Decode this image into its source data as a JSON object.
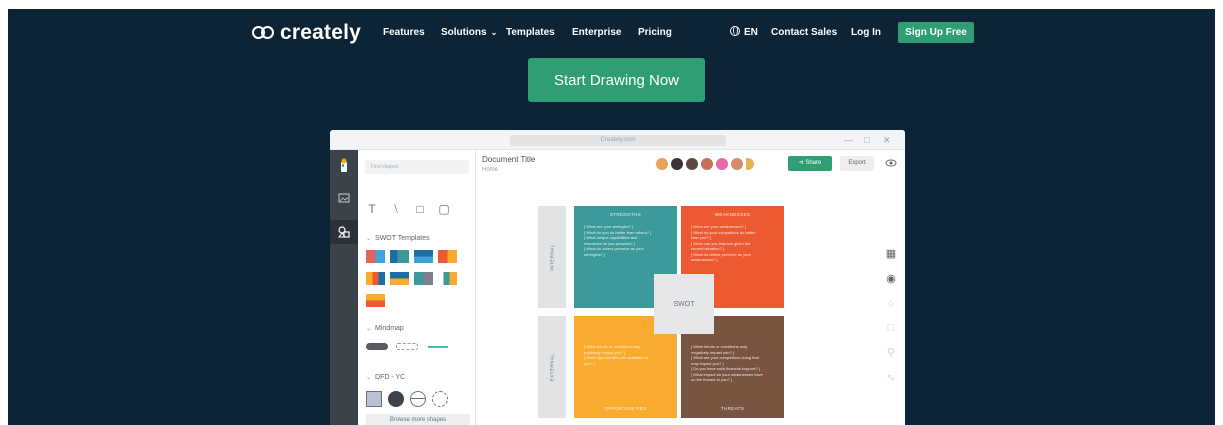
{
  "nav": {
    "logo_text": "creately",
    "features": "Features",
    "solutions": "Solutions",
    "templates": "Templates",
    "enterprise": "Enterprise",
    "pricing": "Pricing",
    "language": "EN",
    "contact_sales": "Contact Sales",
    "login": "Log In",
    "signup": "Sign Up Free"
  },
  "hero": {
    "cta": "Start Drawing Now"
  },
  "app": {
    "url": "Creately.com",
    "search_placeholder": "Find shapes",
    "sections": {
      "swot": "SWOT Templates",
      "mindmap": "Mindmap",
      "dfd": "DFD - YC"
    },
    "browse_more": "Browse more shapes",
    "document_title": "Document Title",
    "breadcrumb_home": "Home",
    "share": "Share",
    "export": "Export"
  },
  "swot": {
    "center": "SWOT",
    "internal": "INTERNAL",
    "external": "EXTERNAL",
    "strengths": {
      "title": "STRENGTHS",
      "lines": [
        "[ What are your strengths? ]",
        "[ What do you do better than others? ]",
        "[ What unique capabilities and",
        "resources do you possess? ]",
        "[ What do others perceive as your",
        "strengths? ]"
      ]
    },
    "weaknesses": {
      "title": "WEAKNESSES",
      "lines": [
        "[ What are your weaknesses? ]",
        "[ What do your competitors do better",
        "than you? ]",
        "[ What can you improve given the",
        "current situation? ]",
        "[ What do others perceive as your",
        "weaknesses? ]"
      ]
    },
    "opportunities": {
      "title": "OPPORTUNITIES",
      "lines": [
        "[ What trends or conditions may",
        "positively impact you? ]",
        "[ What opportunities are available to",
        "you? ]"
      ]
    },
    "threats": {
      "title": "THREATS",
      "lines": [
        "[ What trends or conditions may",
        "negatively impact you? ]",
        "[ What are your competitors doing that",
        "may impact you? ]",
        "[ Do you have solid financial support? ]",
        "[ What impact do your weaknesses have",
        "on the threats to you? ]"
      ]
    }
  },
  "colors": {
    "hero_bg": "#0c2435",
    "brand_green": "#2f9e72",
    "strengths": "#3c9a9a",
    "weaknesses": "#ed5a32",
    "opportunities": "#f8ab2e",
    "threats": "#795441"
  }
}
